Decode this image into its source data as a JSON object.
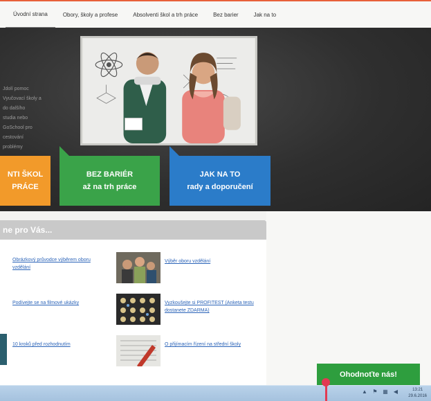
{
  "nav": {
    "items": [
      "Úvodní strana",
      "Obory, školy a profese",
      "Absolventi škol a trh práce",
      "Bez barier",
      "Jak na to"
    ]
  },
  "hero": {
    "side_text": [
      "Jdolí pomoc",
      "Vyučovací školy a",
      "do dalšího",
      "studia nebo",
      "GoSchool pro",
      "cestování",
      "problémy"
    ]
  },
  "tiles": {
    "orange": {
      "line1": "NTI ŠKOL",
      "line2": "PRÁCE"
    },
    "green": {
      "line1": "BEZ BARIÉR",
      "line2": "až na trh práce"
    },
    "blue": {
      "line1": "JAK NA TO",
      "line2": "rady a doporučení"
    }
  },
  "panel": {
    "header": "ne pro Vás...",
    "links": {
      "l1": "Obrázkový průvodce výběrem oboru vzdělání",
      "r1": "Výběr oboru vzdělání",
      "l2": "Podívejte se na filmové ukázky",
      "r2": "Vyzkoušejte si PROFITEST (Anketa testu dostanete ZDARMA)",
      "l3": "10 kroků před rozhodnutím",
      "r3": "O přijímacím řízení na střední školy"
    }
  },
  "rate_button": "Ohodnoťte nás!",
  "taskbar": {
    "clock_time": "13:21",
    "clock_date": "29.6.2016"
  },
  "colors": {
    "orange_tile": "#f29a2a",
    "green_tile": "#3aa349",
    "blue_tile": "#2b7cc9",
    "rate_button": "#2e9e3e",
    "accent": "#e8603a"
  }
}
